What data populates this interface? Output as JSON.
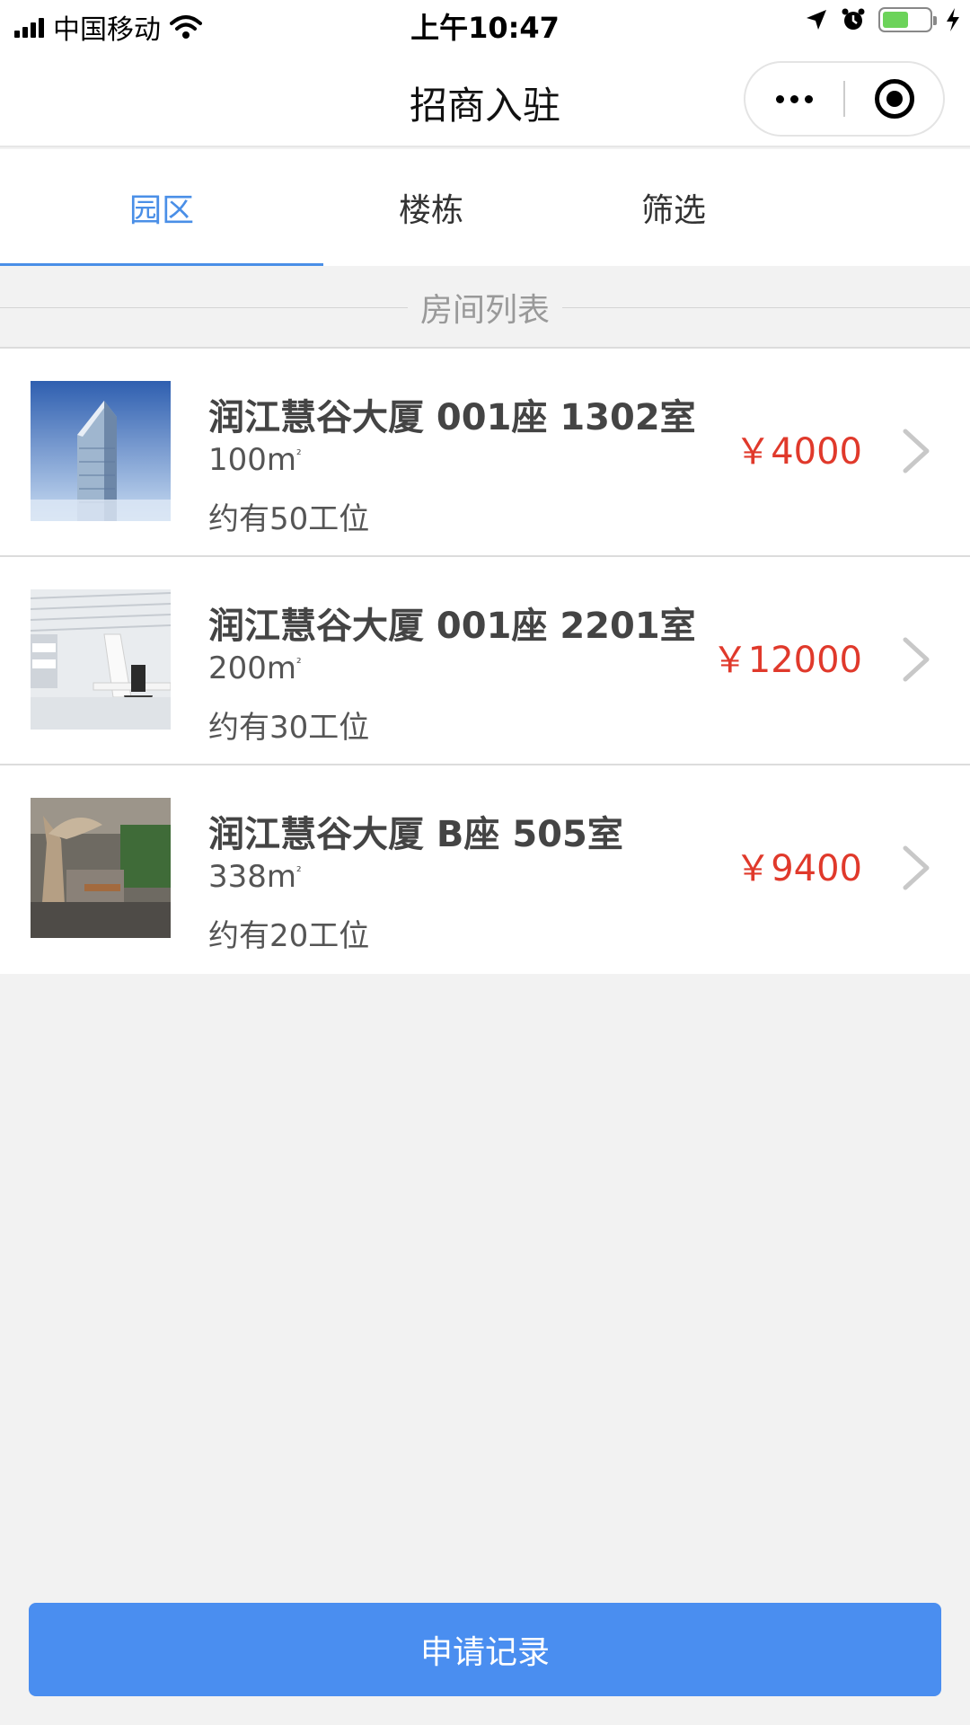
{
  "status_bar": {
    "carrier": "中国移动",
    "time": "上午10:47"
  },
  "nav": {
    "title": "招商入驻"
  },
  "tabs": [
    {
      "label": "园区",
      "active": true
    },
    {
      "label": "楼栋",
      "active": false
    },
    {
      "label": "筛选",
      "active": false
    }
  ],
  "section": {
    "title": "房间列表"
  },
  "rooms": [
    {
      "title": "润江慧谷大厦 001座 1302室",
      "area": "100m",
      "seats": "约有50工位",
      "price": "￥4000",
      "image": "office-tower-photo"
    },
    {
      "title": "润江慧谷大厦 001座 2201室",
      "area": "200m",
      "seats": "约有30工位",
      "price": "￥12000",
      "image": "white-office-interior-photo"
    },
    {
      "title": "润江慧谷大厦 B座 505室",
      "area": "338m",
      "seats": "约有20工位",
      "price": "￥9400",
      "image": "tree-lobby-interior-photo"
    }
  ],
  "area_unit_sup": "²",
  "bottom_button": {
    "label": "申请记录"
  },
  "colors": {
    "accent": "#4a8fe7",
    "price": "#e0392b",
    "button": "#4a8ef0"
  }
}
